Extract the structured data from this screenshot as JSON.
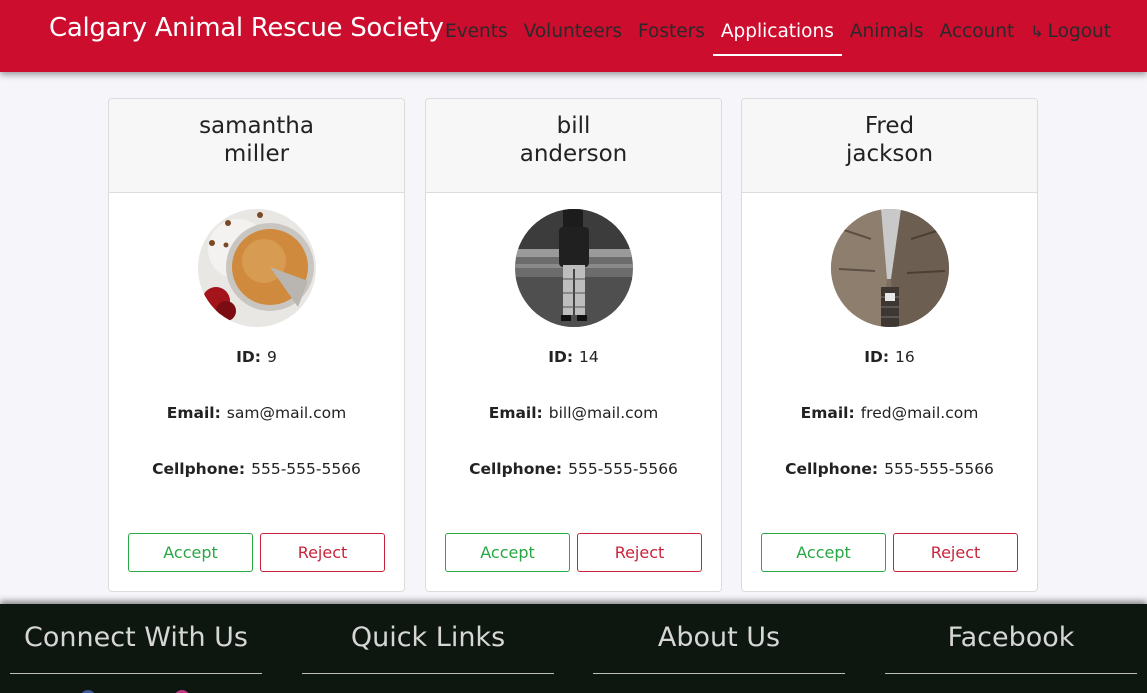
{
  "brand": "Calgary Animal Rescue Society",
  "nav": {
    "events": "Events",
    "volunteers": "Volunteers",
    "fosters": "Fosters",
    "applications": "Applications",
    "animals": "Animals",
    "account": "Account",
    "logout": "Logout",
    "active": "Applications"
  },
  "applicants": [
    {
      "first": "samantha",
      "last": "miller",
      "id": "9",
      "email": "sam@mail.com",
      "cellphone": "555-555-5566",
      "photo": "pie-photo"
    },
    {
      "first": "bill",
      "last": "anderson",
      "id": "14",
      "email": "bill@mail.com",
      "cellphone": "555-555-5566",
      "photo": "person-standing-photo"
    },
    {
      "first": "Fred",
      "last": "jackson",
      "id": "16",
      "email": "fred@mail.com",
      "cellphone": "555-555-5566",
      "photo": "alley-photo"
    }
  ],
  "labels": {
    "id": "ID:",
    "email": "Email:",
    "cellphone": "Cellphone:",
    "accept": "Accept",
    "reject": "Reject"
  },
  "footer": {
    "connect": "Connect With Us",
    "quick_links": "Quick Links",
    "about": "About Us",
    "facebook": "Facebook"
  },
  "colors": {
    "brand_red": "#cc0d2e",
    "accept_green": "#28a745",
    "reject_red": "#c8233a",
    "footer_bg": "#0d160f"
  }
}
